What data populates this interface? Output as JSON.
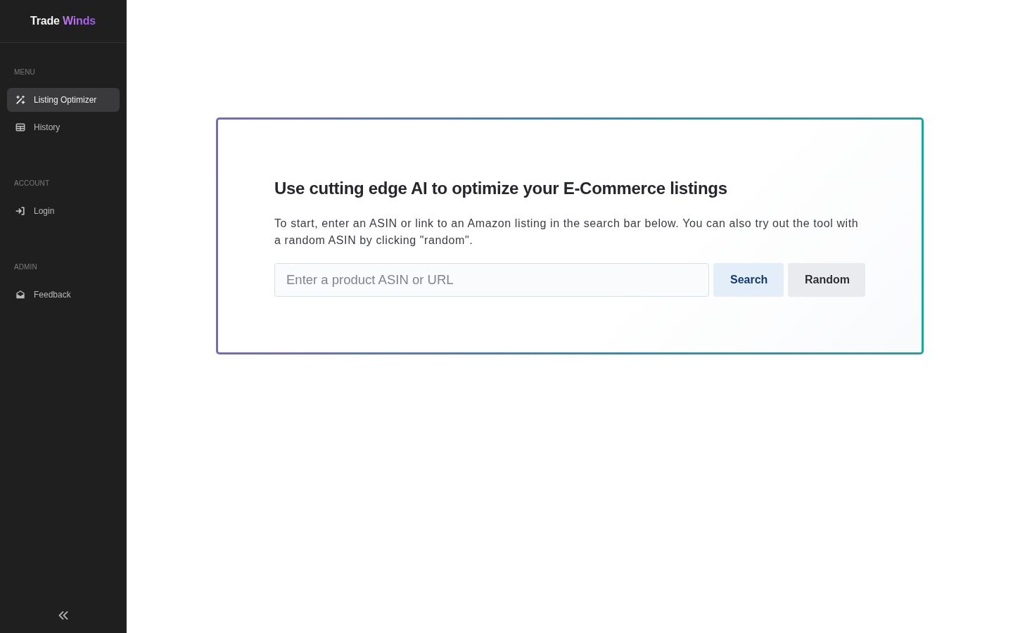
{
  "sidebar": {
    "logo": [
      {
        "text": "Trade",
        "accent": false
      },
      {
        "text": "Winds",
        "accent": true
      }
    ],
    "sections": [
      {
        "label": "MENU",
        "items": [
          {
            "label": "Listing Optimizer",
            "selected": true
          },
          {
            "label": "History",
            "selected": false
          }
        ]
      },
      {
        "label": "ACCOUNT",
        "items": [
          {
            "label": "Login",
            "selected": false
          }
        ]
      },
      {
        "label": "ADMIN",
        "items": [
          {
            "label": "Feedback",
            "selected": false
          }
        ]
      }
    ]
  },
  "main": {
    "heading": "Use cutting edge AI to optimize your E-Commerce listings",
    "description": "To start, enter an ASIN or link to an Amazon listing in the search bar below. You can also try out the tool with a random ASIN by clicking \"random\".",
    "search": {
      "placeholder": "Enter a product ASIN or URL"
    },
    "buttons": [
      {
        "label": "Search",
        "kind": "primary"
      },
      {
        "label": "Random",
        "kind": "secondary"
      }
    ]
  }
}
